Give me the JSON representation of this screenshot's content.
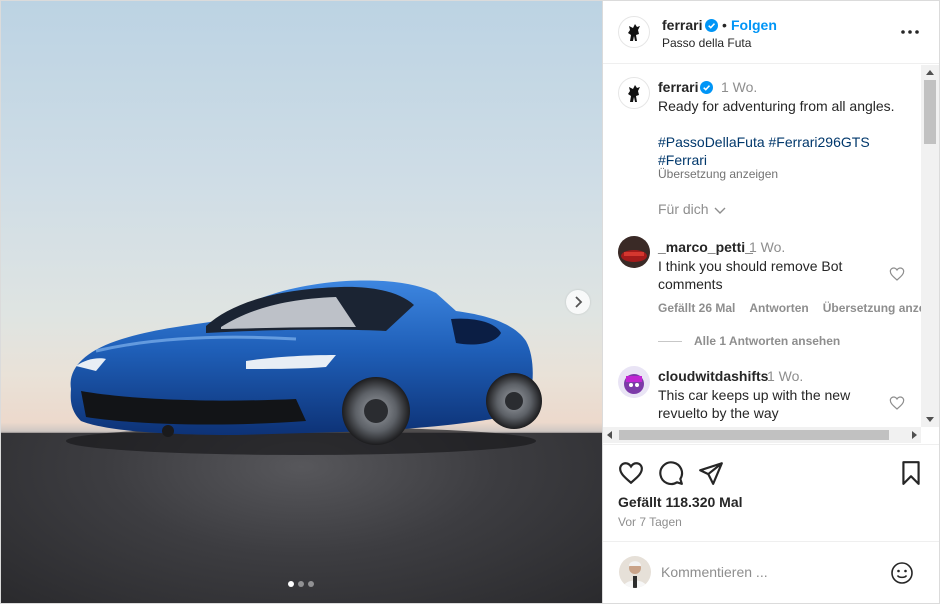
{
  "post": {
    "username": "ferrari",
    "follow_label": "Folgen",
    "separator": "•",
    "location": "Passo della Futa"
  },
  "caption": {
    "username": "ferrari",
    "time": "1 Wo.",
    "text": "Ready for adventuring from all angles.",
    "hashtags": [
      "#PassoDellaFuta",
      "#Ferrari296GTS",
      "#Ferrari"
    ],
    "translate_label": "Übersetzung anzeigen"
  },
  "for_you_label": "Für dich",
  "comments": [
    {
      "username": "_marco_petti_",
      "time": "1 Wo.",
      "text": "I think you should remove Bot comments",
      "likes_label": "Gefällt 26 Mal",
      "reply_label": "Antworten",
      "translate_label": "Übersetzung anzeigen",
      "view_replies_label": "Alle 1 Antworten ansehen"
    },
    {
      "username": "cloudwitdashifts",
      "time": "1 Wo.",
      "text": "This car keeps up with the new revuelto by the way"
    }
  ],
  "likes_label": "Gefällt 118.320 Mal",
  "date_label": "Vor 7 Tagen",
  "add_comment": {
    "placeholder": "Kommentieren ..."
  },
  "carousel": {
    "slide_count": 3,
    "active_index": 0
  },
  "icons": {
    "more": "more-horizontal-icon",
    "like": "heart-icon",
    "comment": "comment-bubble-icon",
    "share": "paper-plane-icon",
    "save": "bookmark-icon",
    "emoji": "smiley-icon",
    "next": "chevron-right-icon"
  },
  "colors": {
    "link_blue": "#0095f6",
    "hashtag": "#00376b",
    "verified": "#0095f6",
    "car_blue": "#1f5fb8"
  }
}
